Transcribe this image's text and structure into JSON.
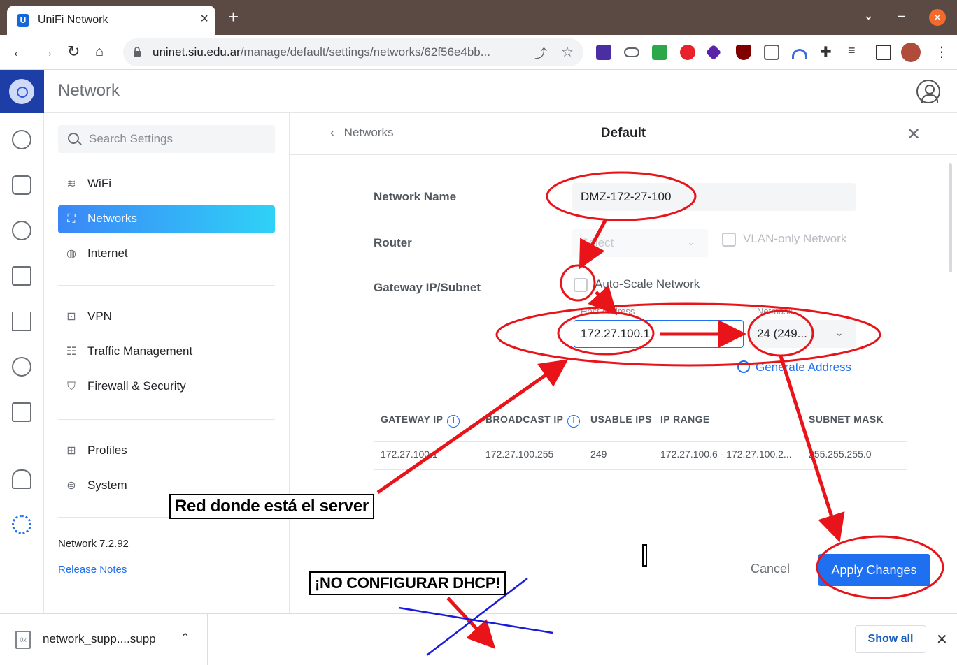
{
  "browser": {
    "tab_title": "UniFi Network",
    "url_host": "uninet.siu.edu.ar",
    "url_path": "/manage/default/settings/networks/62f56e4bb..."
  },
  "app": {
    "title": "Network"
  },
  "sidebar": {
    "search_placeholder": "Search Settings",
    "items": [
      {
        "label": "WiFi",
        "icon": "wifi-icon"
      },
      {
        "label": "Networks",
        "icon": "network-topology-icon",
        "active": true
      },
      {
        "label": "Internet",
        "icon": "globe-icon"
      },
      {
        "label": "VPN",
        "icon": "vpn-icon"
      },
      {
        "label": "Traffic Management",
        "icon": "traffic-icon"
      },
      {
        "label": "Firewall & Security",
        "icon": "shield-icon"
      },
      {
        "label": "Profiles",
        "icon": "profiles-icon"
      },
      {
        "label": "System",
        "icon": "system-icon"
      }
    ],
    "version": "Network 7.2.92",
    "release_notes": "Release Notes"
  },
  "panel": {
    "back_label": "Networks",
    "title": "Default",
    "network_name_label": "Network Name",
    "network_name_value": "DMZ-172-27-100",
    "router_label": "Router",
    "router_placeholder": "Select",
    "vlan_only_label": "VLAN-only Network",
    "gateway_label": "Gateway IP/Subnet",
    "auto_scale_label": "Auto-Scale Network",
    "host_address_label": "Host Address",
    "host_address_value": "172.27.100.1",
    "netmask_label": "Netmask",
    "netmask_value": "24 (249...",
    "generate_address": "Generate Address",
    "table": {
      "headers": [
        "GATEWAY IP",
        "BROADCAST IP",
        "USABLE IPS",
        "IP RANGE",
        "SUBNET MASK"
      ],
      "row": [
        "172.27.100.1",
        "172.27.100.255",
        "249",
        "172.27.100.6 - 172.27.100.2...",
        "255.255.255.0"
      ]
    },
    "cancel_label": "Cancel",
    "apply_label": "Apply Changes"
  },
  "downloads": {
    "file_name": "network_supp....supp",
    "show_all": "Show all"
  },
  "annotations": {
    "note_server": "Red donde está el server",
    "note_dhcp": "¡NO CONFIGURAR DHCP!"
  },
  "colors": {
    "accent": "#1f6ff1",
    "annotation_red": "#e8141a",
    "annotation_blue": "#1a1adb"
  }
}
